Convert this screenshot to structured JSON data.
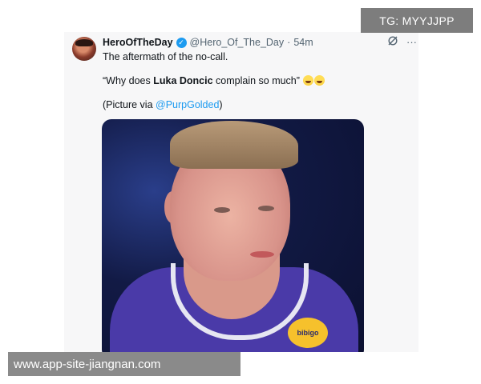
{
  "tweet": {
    "display_name": "HeroOfTheDay",
    "verified_icon": "verified-check-icon",
    "handle": "@Hero_Of_The_Day",
    "separator": "·",
    "time": "54m",
    "line1": "The aftermath of the no-call.",
    "quote_open": "“Why does ",
    "quote_bold": "Luka Doncic",
    "quote_close": " complain so much”",
    "emojis": [
      "laughing-tears-emoji",
      "laughing-tears-emoji"
    ],
    "credit_prefix": "(Picture via ",
    "credit_mention": "@PurpGolded",
    "credit_suffix": ")",
    "actions": {
      "grok_icon": "grok-icon",
      "more_label": "···"
    },
    "photo_sponsor_text": "bibigo"
  },
  "overlays": {
    "tg_badge": "TG: MYYJJPP",
    "url_badge": "www.app-site-jiangnan.com"
  },
  "colors": {
    "accent": "#1d9bf0",
    "text": "#0f1419",
    "muted": "#536471",
    "card_bg": "#f7f7f8",
    "overlay_gray": "#7d7d7d"
  }
}
